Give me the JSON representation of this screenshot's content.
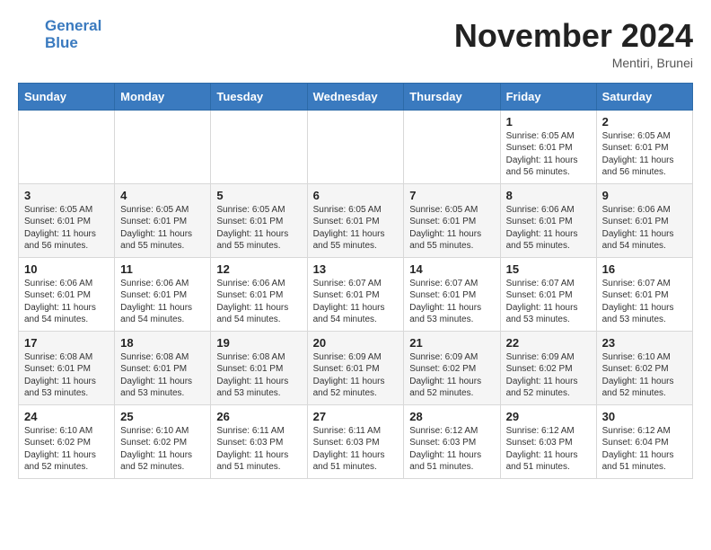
{
  "header": {
    "logo_line1": "General",
    "logo_line2": "Blue",
    "month_title": "November 2024",
    "location": "Mentiri, Brunei"
  },
  "weekdays": [
    "Sunday",
    "Monday",
    "Tuesday",
    "Wednesday",
    "Thursday",
    "Friday",
    "Saturday"
  ],
  "weeks": [
    [
      {
        "day": "",
        "info": ""
      },
      {
        "day": "",
        "info": ""
      },
      {
        "day": "",
        "info": ""
      },
      {
        "day": "",
        "info": ""
      },
      {
        "day": "",
        "info": ""
      },
      {
        "day": "1",
        "info": "Sunrise: 6:05 AM\nSunset: 6:01 PM\nDaylight: 11 hours and 56 minutes."
      },
      {
        "day": "2",
        "info": "Sunrise: 6:05 AM\nSunset: 6:01 PM\nDaylight: 11 hours and 56 minutes."
      }
    ],
    [
      {
        "day": "3",
        "info": "Sunrise: 6:05 AM\nSunset: 6:01 PM\nDaylight: 11 hours and 56 minutes."
      },
      {
        "day": "4",
        "info": "Sunrise: 6:05 AM\nSunset: 6:01 PM\nDaylight: 11 hours and 55 minutes."
      },
      {
        "day": "5",
        "info": "Sunrise: 6:05 AM\nSunset: 6:01 PM\nDaylight: 11 hours and 55 minutes."
      },
      {
        "day": "6",
        "info": "Sunrise: 6:05 AM\nSunset: 6:01 PM\nDaylight: 11 hours and 55 minutes."
      },
      {
        "day": "7",
        "info": "Sunrise: 6:05 AM\nSunset: 6:01 PM\nDaylight: 11 hours and 55 minutes."
      },
      {
        "day": "8",
        "info": "Sunrise: 6:06 AM\nSunset: 6:01 PM\nDaylight: 11 hours and 55 minutes."
      },
      {
        "day": "9",
        "info": "Sunrise: 6:06 AM\nSunset: 6:01 PM\nDaylight: 11 hours and 54 minutes."
      }
    ],
    [
      {
        "day": "10",
        "info": "Sunrise: 6:06 AM\nSunset: 6:01 PM\nDaylight: 11 hours and 54 minutes."
      },
      {
        "day": "11",
        "info": "Sunrise: 6:06 AM\nSunset: 6:01 PM\nDaylight: 11 hours and 54 minutes."
      },
      {
        "day": "12",
        "info": "Sunrise: 6:06 AM\nSunset: 6:01 PM\nDaylight: 11 hours and 54 minutes."
      },
      {
        "day": "13",
        "info": "Sunrise: 6:07 AM\nSunset: 6:01 PM\nDaylight: 11 hours and 54 minutes."
      },
      {
        "day": "14",
        "info": "Sunrise: 6:07 AM\nSunset: 6:01 PM\nDaylight: 11 hours and 53 minutes."
      },
      {
        "day": "15",
        "info": "Sunrise: 6:07 AM\nSunset: 6:01 PM\nDaylight: 11 hours and 53 minutes."
      },
      {
        "day": "16",
        "info": "Sunrise: 6:07 AM\nSunset: 6:01 PM\nDaylight: 11 hours and 53 minutes."
      }
    ],
    [
      {
        "day": "17",
        "info": "Sunrise: 6:08 AM\nSunset: 6:01 PM\nDaylight: 11 hours and 53 minutes."
      },
      {
        "day": "18",
        "info": "Sunrise: 6:08 AM\nSunset: 6:01 PM\nDaylight: 11 hours and 53 minutes."
      },
      {
        "day": "19",
        "info": "Sunrise: 6:08 AM\nSunset: 6:01 PM\nDaylight: 11 hours and 53 minutes."
      },
      {
        "day": "20",
        "info": "Sunrise: 6:09 AM\nSunset: 6:01 PM\nDaylight: 11 hours and 52 minutes."
      },
      {
        "day": "21",
        "info": "Sunrise: 6:09 AM\nSunset: 6:02 PM\nDaylight: 11 hours and 52 minutes."
      },
      {
        "day": "22",
        "info": "Sunrise: 6:09 AM\nSunset: 6:02 PM\nDaylight: 11 hours and 52 minutes."
      },
      {
        "day": "23",
        "info": "Sunrise: 6:10 AM\nSunset: 6:02 PM\nDaylight: 11 hours and 52 minutes."
      }
    ],
    [
      {
        "day": "24",
        "info": "Sunrise: 6:10 AM\nSunset: 6:02 PM\nDaylight: 11 hours and 52 minutes."
      },
      {
        "day": "25",
        "info": "Sunrise: 6:10 AM\nSunset: 6:02 PM\nDaylight: 11 hours and 52 minutes."
      },
      {
        "day": "26",
        "info": "Sunrise: 6:11 AM\nSunset: 6:03 PM\nDaylight: 11 hours and 51 minutes."
      },
      {
        "day": "27",
        "info": "Sunrise: 6:11 AM\nSunset: 6:03 PM\nDaylight: 11 hours and 51 minutes."
      },
      {
        "day": "28",
        "info": "Sunrise: 6:12 AM\nSunset: 6:03 PM\nDaylight: 11 hours and 51 minutes."
      },
      {
        "day": "29",
        "info": "Sunrise: 6:12 AM\nSunset: 6:03 PM\nDaylight: 11 hours and 51 minutes."
      },
      {
        "day": "30",
        "info": "Sunrise: 6:12 AM\nSunset: 6:04 PM\nDaylight: 11 hours and 51 minutes."
      }
    ]
  ]
}
